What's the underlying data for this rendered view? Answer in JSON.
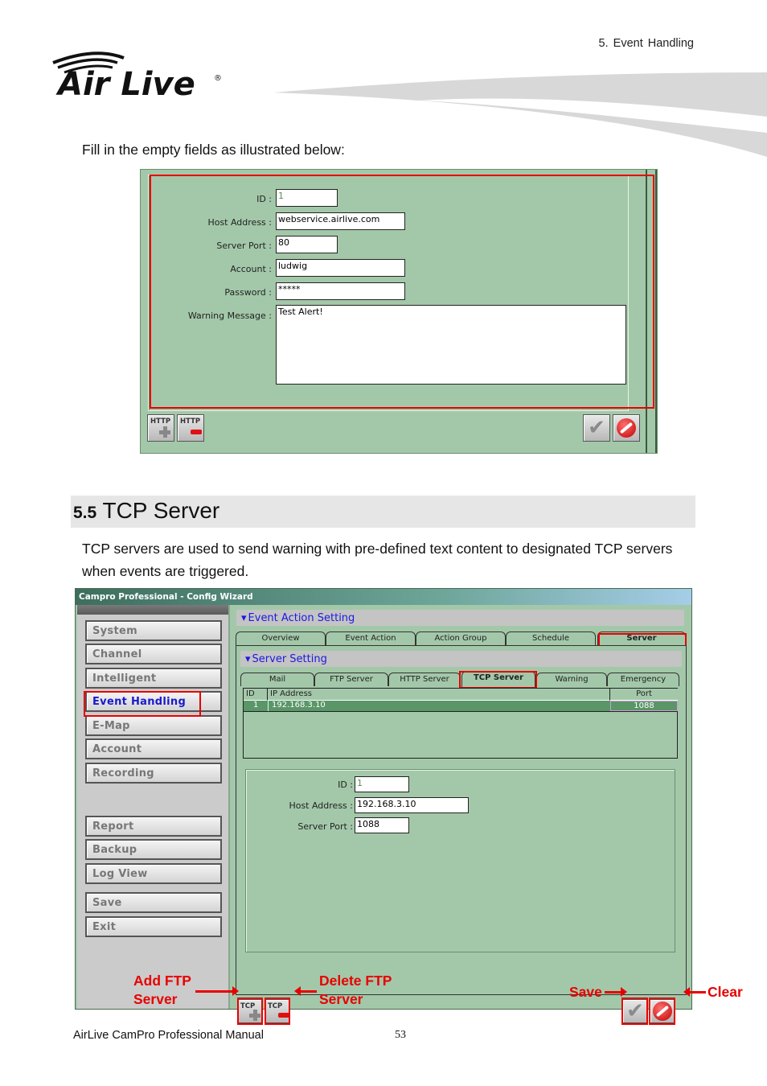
{
  "header": {
    "chapter": "5.  Event  Handling",
    "logo": {
      "text": "Air Live",
      "registered": "®"
    }
  },
  "intro_text": "Fill in the empty fields as illustrated below:",
  "http_form": {
    "fields": [
      {
        "label": "ID :",
        "value": "1"
      },
      {
        "label": "Host Address :",
        "value": "webservice.airlive.com"
      },
      {
        "label": "Server Port :",
        "value": "80"
      },
      {
        "label": "Account :",
        "value": "ludwig"
      },
      {
        "label": "Password :",
        "value": "*****"
      },
      {
        "label": "Warning Message :",
        "value": "Test Alert!"
      }
    ],
    "buttons": {
      "add": "HTTP",
      "delete": "HTTP",
      "save_icon": "check-icon",
      "clear_icon": "no-entry-icon"
    }
  },
  "section": {
    "number": "5.5",
    "title": "TCP Server"
  },
  "section_text": "TCP servers are used to send warning with pre-defined text content to designated TCP servers when events are triggered.",
  "config_wizard": {
    "window_title": "Campro Professional - Config Wizard",
    "sidebar": [
      {
        "label": "System"
      },
      {
        "label": "Channel"
      },
      {
        "label": "Intelligent"
      },
      {
        "label": "Event Handling",
        "active": true
      },
      {
        "label": "E-Map"
      },
      {
        "label": "Account"
      },
      {
        "label": "Recording"
      },
      {
        "label": "Report"
      },
      {
        "label": "Backup"
      },
      {
        "label": "Log View"
      },
      {
        "label": "Save"
      },
      {
        "label": "Exit"
      }
    ],
    "event_header": "Event Action Setting",
    "event_tabs": [
      "Overview",
      "Event Action",
      "Action Group",
      "Schedule",
      "Server"
    ],
    "event_tab_selected": "Server",
    "server_header": "Server Setting",
    "server_tabs": [
      "Mail",
      "FTP Server",
      "HTTP Server",
      "TCP Server",
      "Warning",
      "Emergency"
    ],
    "server_tab_selected": "TCP Server",
    "table": {
      "columns": [
        "ID",
        "IP Address",
        "Port"
      ],
      "rows": [
        {
          "id": "1",
          "ip": "192.168.3.10",
          "port": "1088"
        }
      ]
    },
    "form": [
      {
        "label": "ID :",
        "value": "1"
      },
      {
        "label": "Host Address :",
        "value": "192.168.3.10"
      },
      {
        "label": "Server Port :",
        "value": "1088"
      }
    ],
    "buttons": {
      "add": "TCP",
      "delete": "TCP"
    }
  },
  "annotations": {
    "add": "Add FTP Server",
    "add_line1": "Add FTP",
    "add_line2": "Server",
    "delete_line1": "Delete FTP",
    "delete_line2": "Server",
    "save": "Save",
    "clear": "Clear"
  },
  "footer": {
    "manual": "AirLive  CamPro  Professional  Manual",
    "page": "53"
  },
  "colors": {
    "panel_green": "#a3c8a9",
    "row_green": "#5a9668",
    "highlight_red": "#e80000",
    "link_blue": "#1a1acc"
  }
}
